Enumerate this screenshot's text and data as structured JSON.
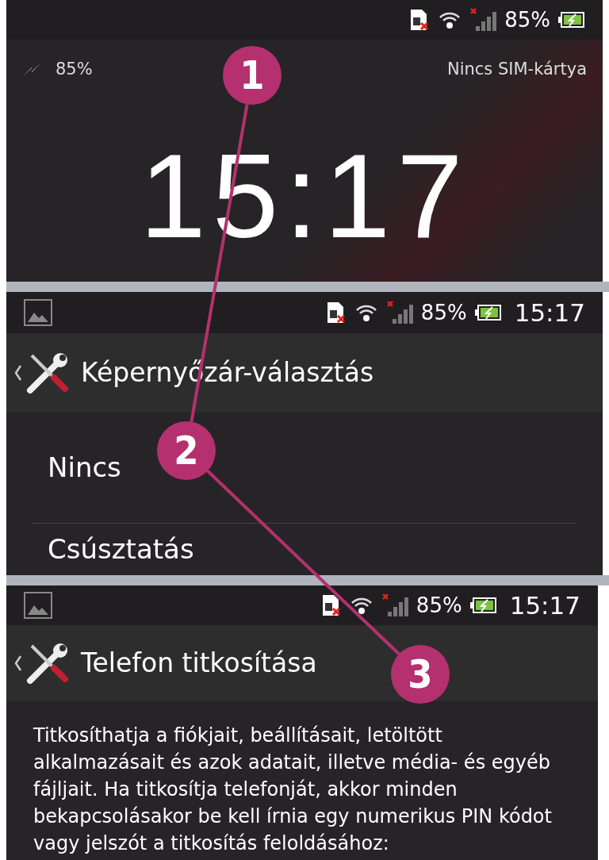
{
  "panels": [
    {
      "kind": "lockscreen",
      "status_bar": {
        "battery": "85%"
      },
      "charge_reading": "85%",
      "sim_status": "Nincs SIM-kártya",
      "clock": "15:17"
    },
    {
      "kind": "list",
      "status_bar": {
        "battery": "85%",
        "time": "15:17"
      },
      "title": "Képernyőzár-választás",
      "items": [
        "Nincs",
        "Csúsztatás"
      ]
    },
    {
      "kind": "text",
      "status_bar": {
        "battery": "85%",
        "time": "15:17"
      },
      "title": "Telefon titkosítása",
      "body": "Titkosíthatja a fiókjait, beállításait, letöltött alkalmazásait és azok adatait, illetve média- és egyéb fájljait. Ha titkosítja telefonját, akkor minden bekapcsolásakor be kell írnia egy numerikus PIN kódot vagy jelszót a titkosítás feloldásához:"
    }
  ],
  "callouts": [
    {
      "label": "1"
    },
    {
      "label": "2"
    },
    {
      "label": "3"
    }
  ]
}
